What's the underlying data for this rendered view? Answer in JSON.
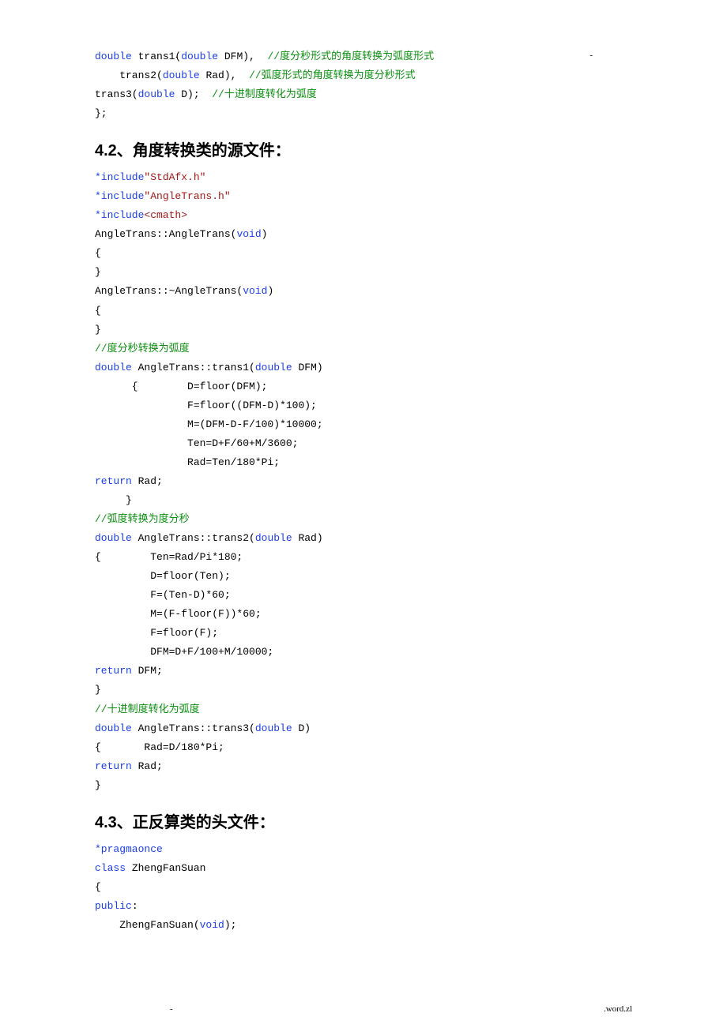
{
  "top": {
    "dot_left": ".",
    "dot_right": "-"
  },
  "block1": {
    "l1a": "double",
    "l1b": " trans1(",
    "l1c": "double",
    "l1d": " DFM),  ",
    "l1e": "//度分秒形式的角度转换为弧度形式",
    "l2a": "    trans2(",
    "l2b": "double",
    "l2c": " Rad),  ",
    "l2d": "//弧度形式的角度转换为度分秒形式",
    "l3a": "trans3(",
    "l3b": "double",
    "l3c": " D);  ",
    "l3d": "//十进制度转化为弧度",
    "l4": "};"
  },
  "heading42": "4.2、角度转换类的源文件：",
  "block2": {
    "l1a": "*include",
    "l1b": "\"StdAfx.h\"",
    "l2a": "*include",
    "l2b": "\"AngleTrans.h\"",
    "l3a": "*include",
    "l3b": "<cmath>",
    "l4a": "AngleTrans::AngleTrans(",
    "l4b": "void",
    "l4c": ")",
    "l5": "{",
    "l6": "}",
    "l7a": "AngleTrans::~AngleTrans(",
    "l7b": "void",
    "l7c": ")",
    "l8": "{",
    "l9": "}",
    "l10": "//度分秒转换为弧度",
    "l11a": "double",
    "l11b": " AngleTrans::trans1(",
    "l11c": "double",
    "l11d": " DFM)",
    "l12": "      {        D=floor(DFM);",
    "l13": "               F=floor((DFM-D)*100);",
    "l14": "               M=(DFM-D-F/100)*10000;",
    "l15": "               Ten=D+F/60+M/3600;",
    "l16": "               Rad=Ten/180*Pi;",
    "l17a": "return",
    "l17b": " Rad;",
    "l18": "     }",
    "l19": "//弧度转换为度分秒",
    "l20a": "double",
    "l20b": " AngleTrans::trans2(",
    "l20c": "double",
    "l20d": " Rad)",
    "l21": "{        Ten=Rad/Pi*180;",
    "l22": "         D=floor(Ten);",
    "l23": "         F=(Ten-D)*60;",
    "l24": "         M=(F-floor(F))*60;",
    "l25": "         F=floor(F);",
    "l26": "         DFM=D+F/100+M/10000;",
    "l27a": "return",
    "l27b": " DFM;",
    "l28": "}",
    "l29": "//十进制度转化为弧度",
    "l30a": "double",
    "l30b": " AngleTrans::trans3(",
    "l30c": "double",
    "l30d": " D)",
    "l31": "{       Rad=D/180*Pi;",
    "l32a": "return",
    "l32b": " Rad;",
    "l33": "}"
  },
  "heading43": "4.3、正反算类的头文件：",
  "block3": {
    "l1": "*pragmaonce",
    "l2a": "class",
    "l2b": " ZhengFanSuan",
    "l3": "{",
    "l4a": "public",
    "l4b": ":",
    "l5a": "    ZhengFanSuan(",
    "l5b": "void",
    "l5c": ");"
  },
  "footer": {
    "left": "-",
    "right": ".word.zl"
  }
}
